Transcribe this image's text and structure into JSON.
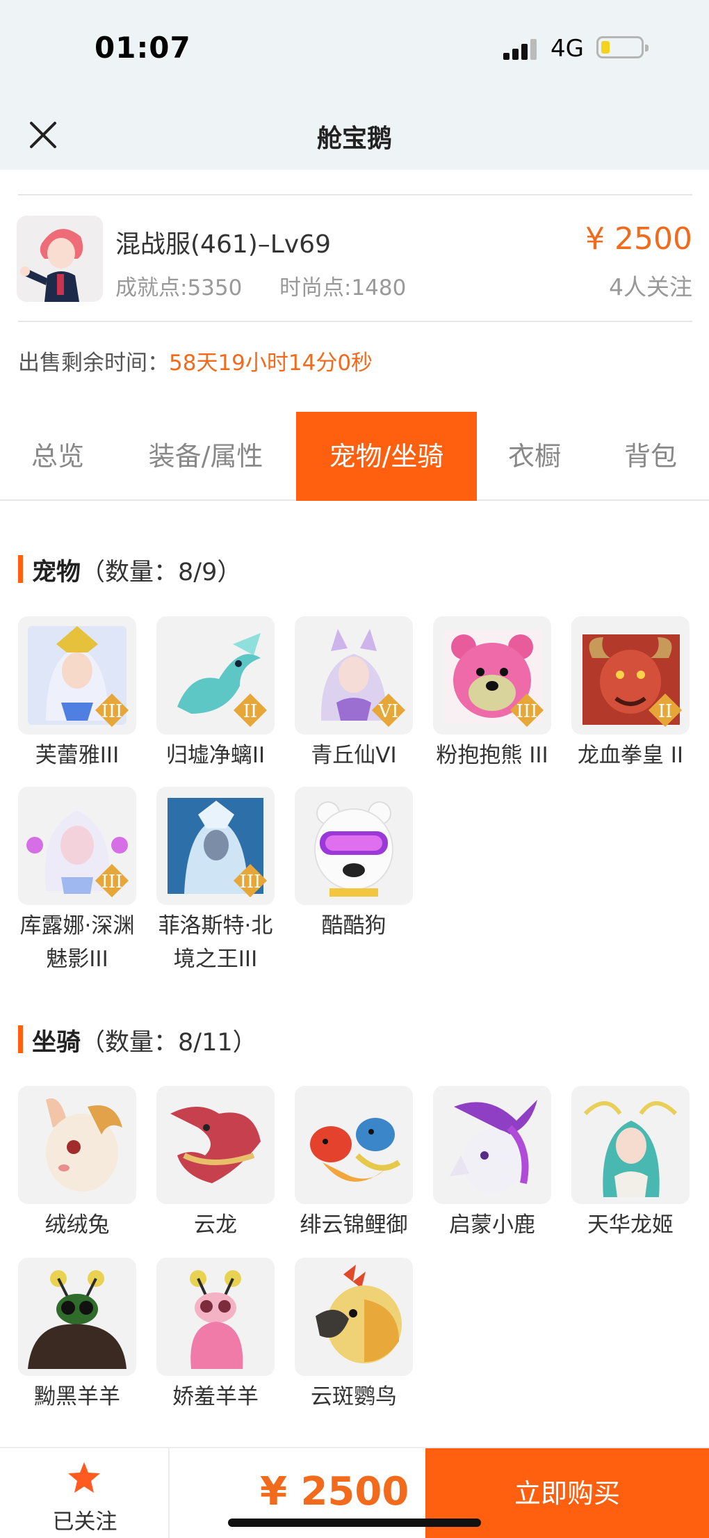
{
  "status": {
    "time": "01:07",
    "network": "4G"
  },
  "nav": {
    "title": "舱宝鹅"
  },
  "account": {
    "server": "混战服(461)–Lv69",
    "achievement": "成就点:5350",
    "fashion": "时尚点:1480",
    "price": "¥ 2500",
    "watchers": "4人关注"
  },
  "remaining": {
    "label": "出售剩余时间：",
    "value": "58天19小时14分0秒"
  },
  "tabs": [
    "总览",
    "装备/属性",
    "宠物/坐骑",
    "衣橱",
    "背包"
  ],
  "pets": {
    "title": "宠物",
    "count": "（数量：8/9）",
    "items": [
      "芙蕾雅III",
      "归墟净螭II",
      "青丘仙VI",
      "粉抱抱熊 III",
      "龙血拳皇 II",
      "库露娜·深渊魅影III",
      "菲洛斯特·北境之王III",
      "酷酷狗"
    ]
  },
  "mounts": {
    "title": "坐骑",
    "count": "（数量：8/11）",
    "items": [
      "绒绒兔",
      "云龙",
      "绯云锦鲤御",
      "启蒙小鹿",
      "天华龙姬",
      "黝黑羊羊",
      "娇羞羊羊",
      "云斑鹦鸟"
    ]
  },
  "bottom": {
    "follow_label": "已关注",
    "price": "¥ 2500",
    "buy_label": "立即购买"
  },
  "colors": {
    "accent": "#ff6010",
    "price": "#f26a1b"
  }
}
